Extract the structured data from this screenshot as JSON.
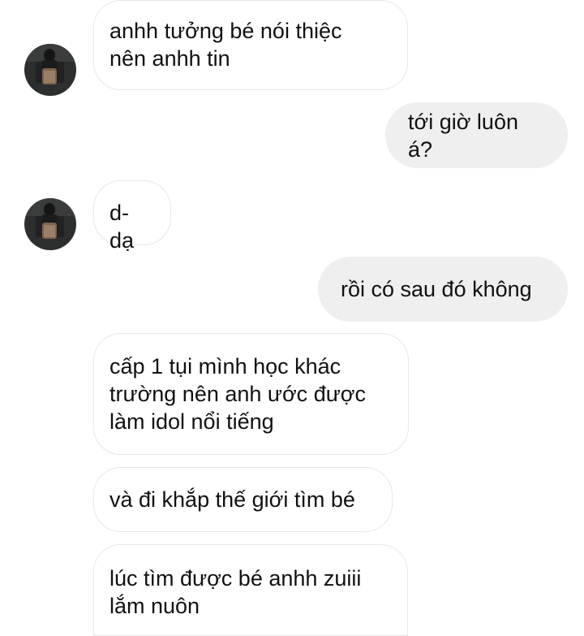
{
  "conversation": {
    "messages": [
      {
        "sender": "other",
        "text": "anhh tưởng bé nói thiệc\nnên anhh tin"
      },
      {
        "sender": "me",
        "text": "tới giờ luôn á?"
      },
      {
        "sender": "other",
        "text": "d-dạ"
      },
      {
        "sender": "me",
        "text": "rồi có sau đó không"
      },
      {
        "sender": "other",
        "text": "cấp 1 tụi mình học khác\ntrường nên anh ước được\nlàm idol nổi tiếng"
      },
      {
        "sender": "other",
        "text": "và đi khắp thế giới tìm bé"
      },
      {
        "sender": "other",
        "text": "lúc tìm được bé anhh zuiii\nlắm nuôn"
      }
    ]
  },
  "colors": {
    "incoming_bubble": "#ffffff",
    "incoming_border": "#e7e7e7",
    "outgoing_bubble": "#efefef",
    "text": "#111111"
  }
}
